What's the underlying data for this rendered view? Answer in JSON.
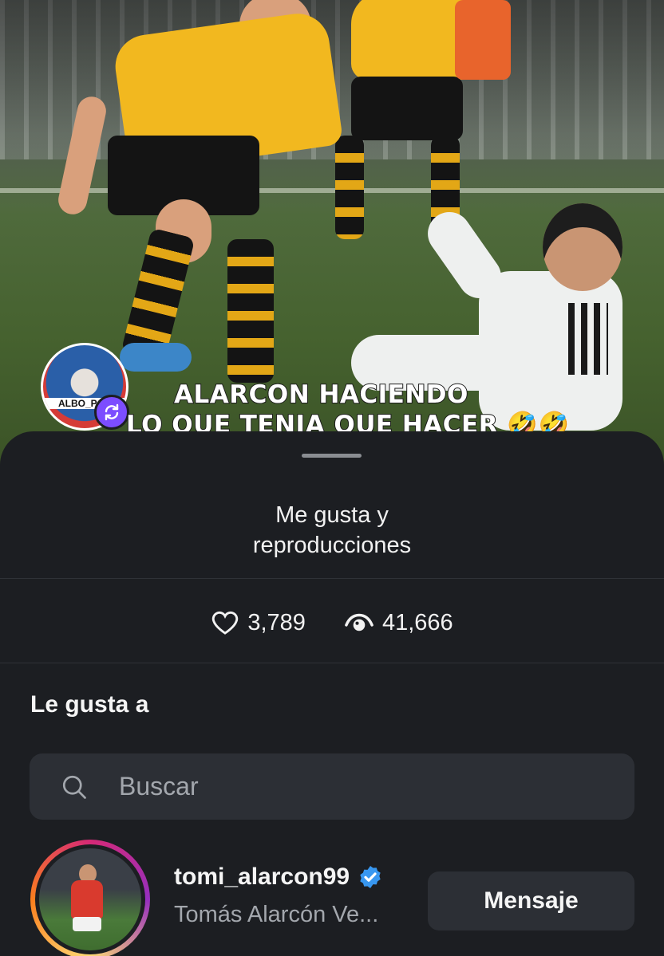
{
  "video": {
    "caption_line1": "ALARCON HACIENDO",
    "caption_line2": "LO QUE TENIA QUE HACER 🤣🤣🤣",
    "poster_avatar_tag": "ALBO_POP",
    "repost_icon": "repost-icon"
  },
  "sheet": {
    "title": "Me gusta y reproducciones",
    "likes_icon": "heart-icon",
    "likes_count": "3,789",
    "views_icon": "eye-icon",
    "views_count": "41,666",
    "section_label": "Le gusta a"
  },
  "search": {
    "icon": "search-icon",
    "placeholder": "Buscar"
  },
  "users": [
    {
      "username": "tomi_alarcon99",
      "verified": true,
      "full_name": "Tomás Alarcón Ve...",
      "action_label": "Mensaje"
    }
  ],
  "colors": {
    "sheet_bg": "#1c1e22",
    "field_bg": "#2c2f35",
    "verified": "#3897f0",
    "muted_text": "#a3a7ad"
  }
}
